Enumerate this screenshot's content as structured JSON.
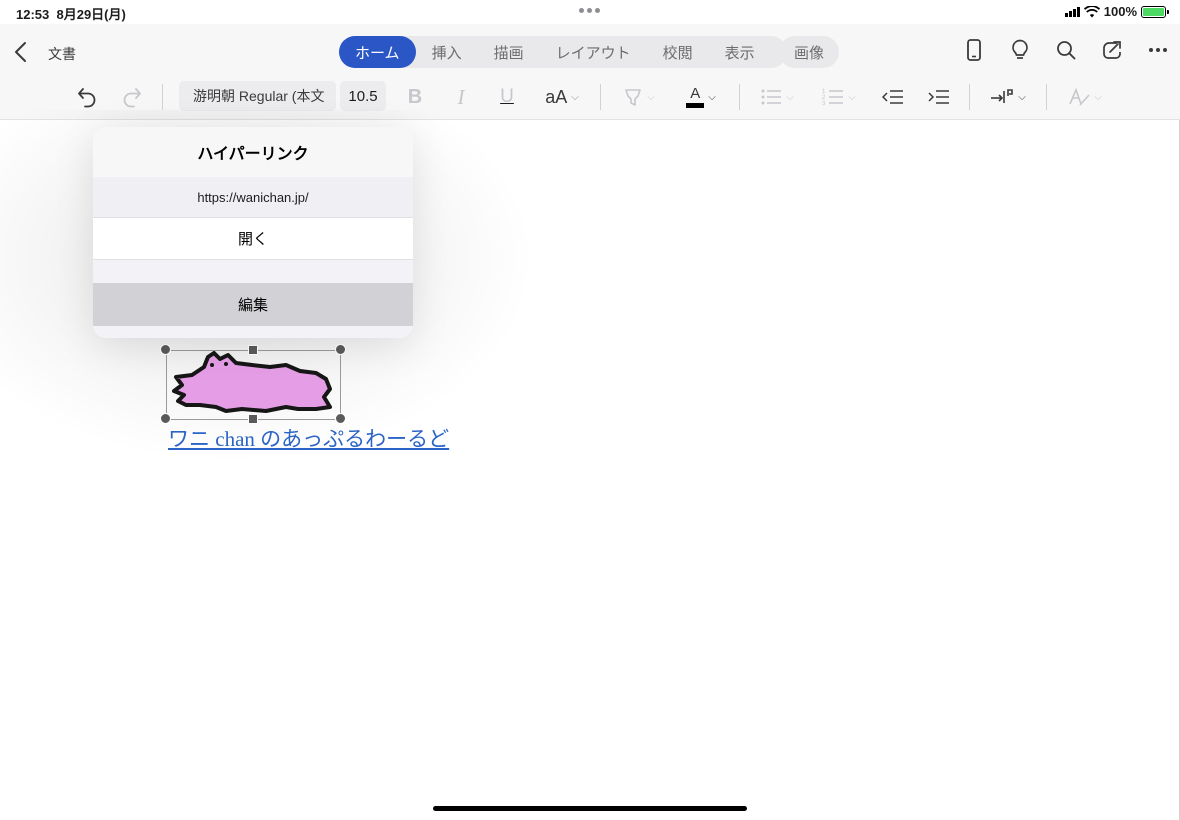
{
  "status": {
    "time": "12:53",
    "date": "8月29日(月)",
    "battery": "100%"
  },
  "toolbar": {
    "doc_title": "文書",
    "tabs": [
      {
        "label": "ホーム",
        "active": true
      },
      {
        "label": "挿入",
        "active": false
      },
      {
        "label": "描画",
        "active": false
      },
      {
        "label": "レイアウト",
        "active": false
      },
      {
        "label": "校閲",
        "active": false
      },
      {
        "label": "表示",
        "active": false
      }
    ],
    "image_tab": "画像",
    "font_name": "游明朝 Regular (本文",
    "font_size": "10.5",
    "font_size_button": "aA",
    "bold": "B",
    "italic": "I",
    "underline": "U",
    "font_color_letter": "A",
    "accent_color": "#2b56c6"
  },
  "popover": {
    "title": "ハイパーリンク",
    "url": "https://wanichan.jp/",
    "open_label": "開く",
    "edit_label": "編集"
  },
  "document": {
    "link_text": "ワニ chan のあっぷるわーるど",
    "link_color": "#2b64c6"
  }
}
